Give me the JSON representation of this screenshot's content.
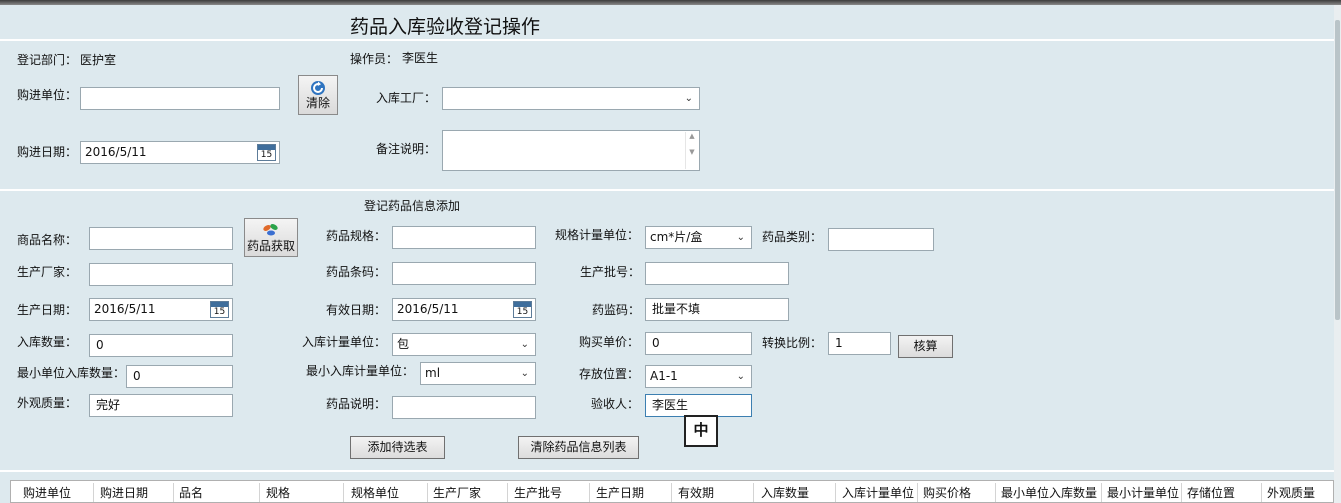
{
  "title": "药品入库验收登记操作",
  "header": {
    "dept_label": "登记部门：",
    "dept_value": "医护室",
    "operator_label": "操作员：",
    "operator_value": "李医生",
    "supplier_label": "购进单位：",
    "supplier_value": "",
    "clear_label": "清除",
    "factory_label": "入库工厂：",
    "factory_value": "",
    "purchase_date_label": "购进日期：",
    "purchase_date_value": "2016/5/11",
    "remark_label": "备注说明："
  },
  "section2": {
    "title": "登记药品信息添加",
    "product_name_label": "商品名称：",
    "product_name_value": "",
    "get_drug_label": "药品获取",
    "spec_label": "药品规格：",
    "spec_value": "",
    "spec_unit_label": "规格计量单位：",
    "spec_unit_value": "cm*片/盒",
    "category_label": "药品类别：",
    "category_value": "",
    "manufacturer_label": "生产厂家：",
    "manufacturer_value": "",
    "barcode_label": "药品条码：",
    "barcode_value": "",
    "batch_label": "生产批号：",
    "batch_value": "",
    "mfg_date_label": "生产日期：",
    "mfg_date_value": "2016/5/11",
    "exp_date_label": "有效日期：",
    "exp_date_value": "2016/5/11",
    "supervise_label": "药监码：",
    "supervise_value": "批量不填",
    "qty_label": "入库数量：",
    "qty_value": "0",
    "unit_label": "入库计量单位：",
    "unit_value": "包",
    "price_label": "购买单价：",
    "price_value": "0",
    "ratio_label": "转换比例：",
    "ratio_value": "1",
    "calc_label": "核算",
    "min_qty_label": "最小单位入库数量：",
    "min_qty_value": "0",
    "min_unit_label": "最小入库计量单位：",
    "min_unit_value": "ml",
    "location_label": "存放位置：",
    "location_value": "A1-1",
    "appearance_label": "外观质量：",
    "appearance_value": "完好",
    "desc_label": "药品说明：",
    "desc_value": "",
    "inspector_label": "验收人：",
    "inspector_value": "李医生",
    "ime_label": "中",
    "add_label": "添加待选表",
    "clear_list_label": "清除药品信息列表"
  },
  "grid": {
    "columns": [
      "购进单位",
      "购进日期",
      "品名",
      "规格",
      "规格单位",
      "生产厂家",
      "生产批号",
      "生产日期",
      "有效期",
      "入库数量",
      "入库计量单位",
      "购买价格",
      "最小单位入库数量",
      "最小计量单位",
      "存储位置",
      "外观质量"
    ]
  }
}
